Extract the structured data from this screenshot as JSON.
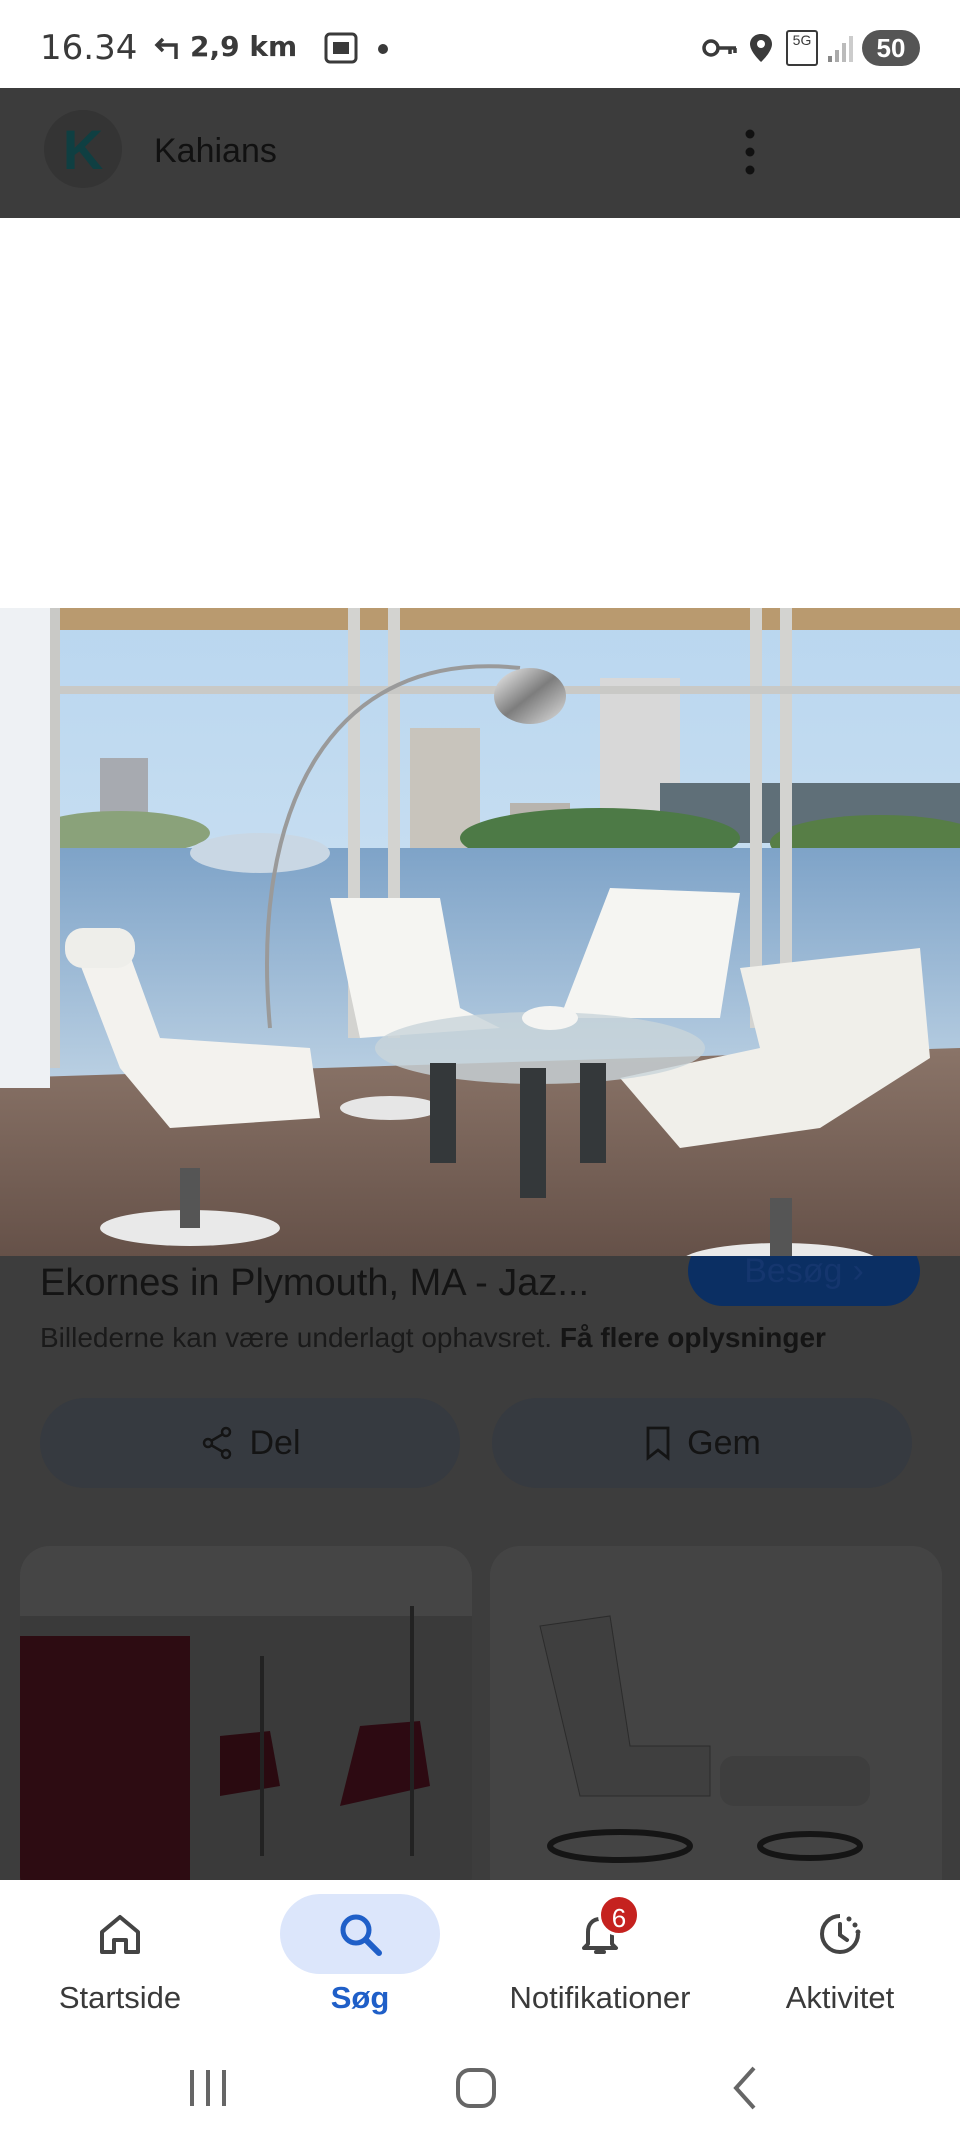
{
  "status_bar": {
    "time": "16.34",
    "nav_distance": "2,9 km",
    "battery": "50",
    "network": "5G"
  },
  "app_header": {
    "logo_letter": "K",
    "title": "Kahians"
  },
  "result": {
    "title": "Ekornes in Plymouth, MA - Jaz...",
    "visit_label": "Besøg",
    "copyright_text": "Billederne kan være underlagt ophavsret.",
    "copyright_link": "Få flere oplysninger",
    "share_label": "Del",
    "save_label": "Gem"
  },
  "bottom_nav": {
    "items": [
      {
        "label": "Startside",
        "icon": "home-icon"
      },
      {
        "label": "Søg",
        "icon": "search-icon"
      },
      {
        "label": "Notifikationer",
        "icon": "bell-icon"
      },
      {
        "label": "Aktivitet",
        "icon": "history-icon"
      }
    ],
    "notification_count": "6"
  },
  "colors": {
    "active_tab": "#1f5fc8",
    "active_tab_bg": "#dce6fb",
    "badge": "#c5221f",
    "header_dim": "#3c3c3c"
  }
}
